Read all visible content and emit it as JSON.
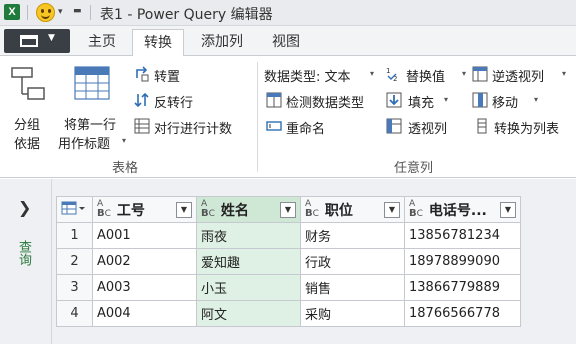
{
  "window": {
    "title": "表1 - Power Query 编辑器",
    "app_icon": "X"
  },
  "tabs": [
    "主页",
    "转换",
    "添加列",
    "视图"
  ],
  "active_tab": "转换",
  "ribbon": {
    "table_group": {
      "label": "表格",
      "group_by": [
        "分组",
        "依据"
      ],
      "use_first_row": [
        "将第一行",
        "用作标题"
      ],
      "transpose": "转置",
      "reverse_rows": "反转行",
      "count_rows": "对行进行计数"
    },
    "anycol_group": {
      "label": "任意列",
      "data_type": "数据类型: 文本",
      "detect_type": "检测数据类型",
      "rename": "重命名",
      "replace_values": "替换值",
      "fill": "填充",
      "pivot": "透视列",
      "unpivot": "逆透视列",
      "move": "移动",
      "to_list": "转换为列表"
    }
  },
  "nav": {
    "label": "查询"
  },
  "table": {
    "columns": [
      "工号",
      "姓名",
      "职位",
      "电话号..."
    ],
    "rows": [
      [
        "1",
        "A001",
        "雨夜",
        "财务",
        "13856781234"
      ],
      [
        "2",
        "A002",
        "爱知趣",
        "行政",
        "18978899090"
      ],
      [
        "3",
        "A003",
        "小玉",
        "销售",
        "13866779889"
      ],
      [
        "4",
        "A004",
        "阿文",
        "采购",
        "18766566778"
      ]
    ]
  },
  "colors": {
    "accent_green": "#2b7a3d",
    "selected_column": "#dff1e4",
    "excel_green": "#1f7a3c"
  }
}
